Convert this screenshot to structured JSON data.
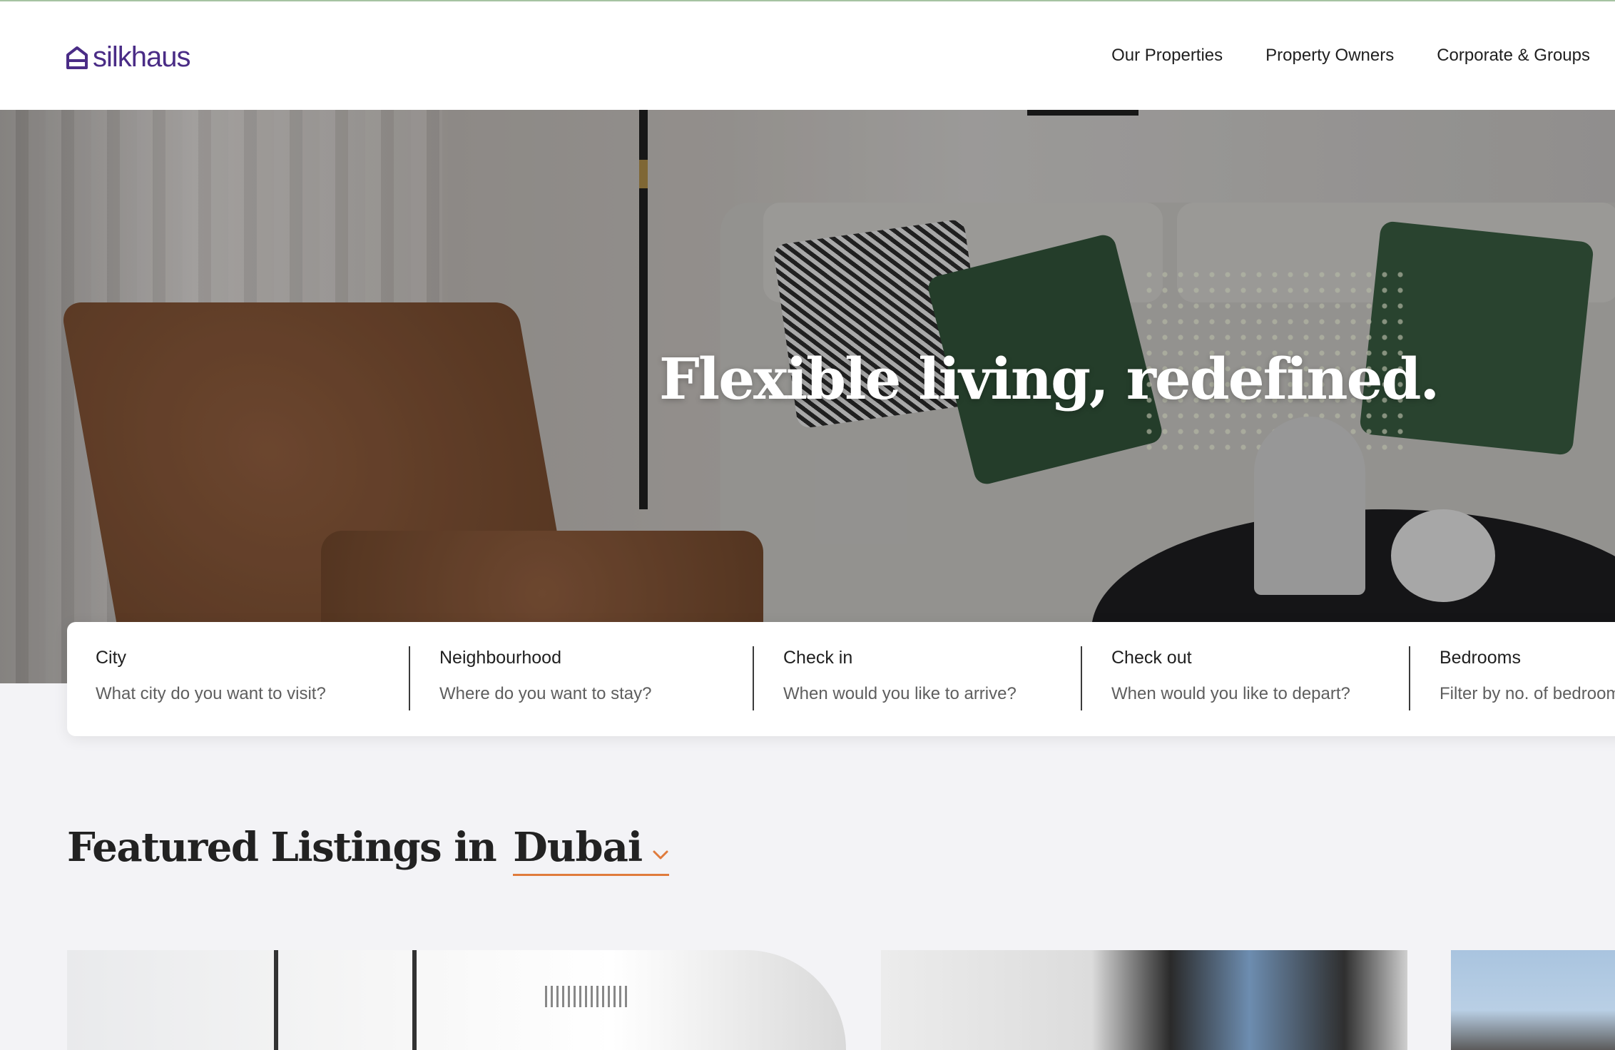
{
  "brand": {
    "name": "silkhaus",
    "color": "#4a2c86"
  },
  "nav": {
    "items": [
      {
        "label": "Our Properties"
      },
      {
        "label": "Property Owners"
      },
      {
        "label": "Corporate & Groups"
      }
    ]
  },
  "hero": {
    "title": "Flexible living, redefined."
  },
  "search": {
    "fields": [
      {
        "label": "City",
        "placeholder": "What city do you want to visit?"
      },
      {
        "label": "Neighbourhood",
        "placeholder": "Where do you want to stay?"
      },
      {
        "label": "Check in",
        "placeholder": "When would you like to arrive?"
      },
      {
        "label": "Check out",
        "placeholder": "When would you like to depart?"
      },
      {
        "label": "Bedrooms",
        "placeholder": "Filter by no. of bedrooms"
      }
    ]
  },
  "featured": {
    "title": "Featured Listings in",
    "city": "Dubai",
    "accent_color": "#e07b3c"
  },
  "icons": [
    "house-logo-icon",
    "chevron-down-icon"
  ]
}
